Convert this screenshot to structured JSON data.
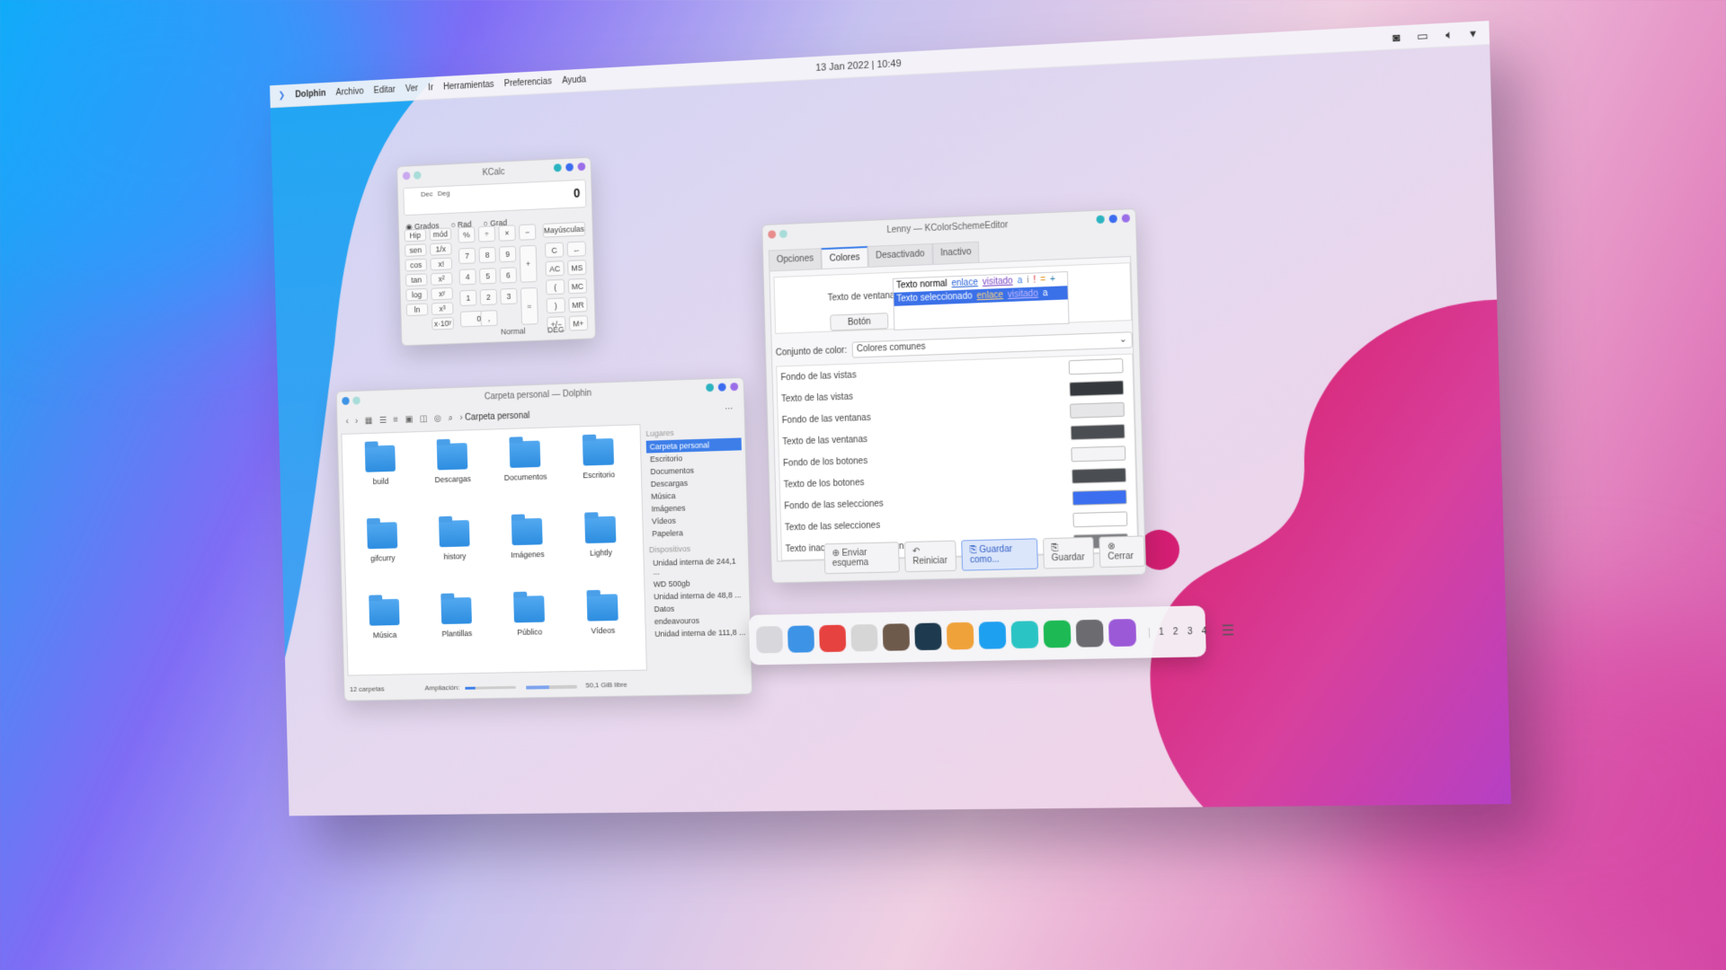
{
  "panel": {
    "app": "Dolphin",
    "menus": [
      "Archivo",
      "Editar",
      "Ver",
      "Ir",
      "Herramientas",
      "Preferencias",
      "Ayuda"
    ],
    "clock": "13 Jan 2022 | 10:49",
    "tray_icons": [
      "camera-icon",
      "display-icon",
      "volume-icon",
      "dropdown-arrow-icon"
    ]
  },
  "kcalc": {
    "title": "KCalc",
    "display_value": "0",
    "display_flags": [
      "Dec",
      "Deg"
    ],
    "angle_options": [
      "Grados",
      "Rad",
      "Grad"
    ],
    "angle_selected": "Grados",
    "func_buttons": [
      [
        "Hip",
        "mód"
      ],
      [
        "sen",
        "1/x"
      ],
      [
        "cos",
        "x!"
      ],
      [
        "tan",
        "x²"
      ],
      [
        "log",
        "xʸ"
      ],
      [
        "ln",
        "x³"
      ],
      [
        "",
        "x·10ʸ"
      ]
    ],
    "num_buttons": [
      [
        "%",
        "÷",
        "×",
        "−"
      ],
      [
        "7",
        "8",
        "9",
        "+"
      ],
      [
        "4",
        "5",
        "6",
        ""
      ],
      [
        "1",
        "2",
        "3",
        "="
      ],
      [
        "0",
        ",",
        "",
        ""
      ]
    ],
    "side_buttons": [
      "Mayúsculas",
      "C",
      "←",
      "AC",
      "MS",
      "(",
      "MC",
      ")",
      "MR",
      "+/−",
      "M+"
    ],
    "status": [
      "Normal",
      "DEG"
    ]
  },
  "dolphin": {
    "title": "Carpeta personal — Dolphin",
    "breadcrumb": "Carpeta personal",
    "folders": [
      "build",
      "Descargas",
      "Documentos",
      "Escritorio",
      "gifcurry",
      "history",
      "Imágenes",
      "Lightly",
      "Música",
      "Plantillas",
      "Público",
      "Vídeos"
    ],
    "places_header": "Lugares",
    "places": [
      "Carpeta personal",
      "Escritorio",
      "Documentos",
      "Descargas",
      "Música",
      "Imágenes",
      "Vídeos",
      "Papelera"
    ],
    "devices_header": "Dispositivos",
    "devices": [
      "Unidad interna de 244,1 ...",
      "WD 500gb",
      "Unidad interna de 48,8 ...",
      "Datos",
      "endeavouros",
      "Unidad interna de 111,8 ..."
    ],
    "status_count": "12 carpetas",
    "zoom_label": "Ampliación:",
    "zoom_level": 0.2,
    "free_space": "50,1 GiB libre",
    "free_fraction": 0.45
  },
  "colorEditor": {
    "title": "Lenny — KColorSchemeEditor",
    "tabs": [
      "Opciones",
      "Colores",
      "Desactivado",
      "Inactivo"
    ],
    "active_tab": "Colores",
    "window_text_label": "Texto de ventana",
    "button_label": "Botón",
    "normal_row": [
      "Texto normal",
      "enlace",
      "visitado",
      "a",
      "i",
      "!",
      "=",
      "+"
    ],
    "selected_row": [
      "Texto seleccionado",
      "enlace",
      "visitado",
      "a"
    ],
    "set_label": "Conjunto de color:",
    "set_value": "Colores comunes",
    "color_rows": [
      {
        "label": "Fondo de las vistas",
        "color": "#ffffff"
      },
      {
        "label": "Texto de las vistas",
        "color": "#35393d"
      },
      {
        "label": "Fondo de las ventanas",
        "color": "#e6e6e9"
      },
      {
        "label": "Texto de las ventanas",
        "color": "#4a4d52"
      },
      {
        "label": "Fondo de los botones",
        "color": "#f4f4f6"
      },
      {
        "label": "Texto de los botones",
        "color": "#4a4d52"
      },
      {
        "label": "Fondo de las selecciones",
        "color": "#3b6ff0"
      },
      {
        "label": "Texto de las selecciones",
        "color": "#ffffff"
      },
      {
        "label": "Texto inactivo de las selecciones",
        "color": "#7c7e82"
      }
    ],
    "buttons": [
      "Enviar esquema",
      "Reiniciar",
      "Guardar como...",
      "Guardar",
      "Cerrar"
    ]
  },
  "dock": {
    "apps": [
      {
        "name": "terminal-icon",
        "color": "#d7d7dc"
      },
      {
        "name": "folder-icon",
        "color": "#3d93e6"
      },
      {
        "name": "vivaldi-icon",
        "color": "#e6423f"
      },
      {
        "name": "inkscape-icon",
        "color": "#d6d6d6"
      },
      {
        "name": "gimp-icon",
        "color": "#6e5a4b"
      },
      {
        "name": "endeavour-icon",
        "color": "#1e3a4e"
      },
      {
        "name": "color-picker-icon",
        "color": "#f0a23a"
      },
      {
        "name": "kdeconnect-icon",
        "color": "#1ea0f0"
      },
      {
        "name": "music-app-icon",
        "color": "#2bc4c4"
      },
      {
        "name": "spotify-icon",
        "color": "#1db954"
      },
      {
        "name": "settings-icon",
        "color": "#6c6c70"
      },
      {
        "name": "calculator-icon",
        "color": "#9b59d8"
      }
    ],
    "pager": [
      "1",
      "2",
      "3",
      "4"
    ]
  },
  "colors": {
    "accent": "#3d7ee9",
    "close": "#2bb3c0",
    "max": "#3b6cf0",
    "min": "#9a6ee8"
  }
}
